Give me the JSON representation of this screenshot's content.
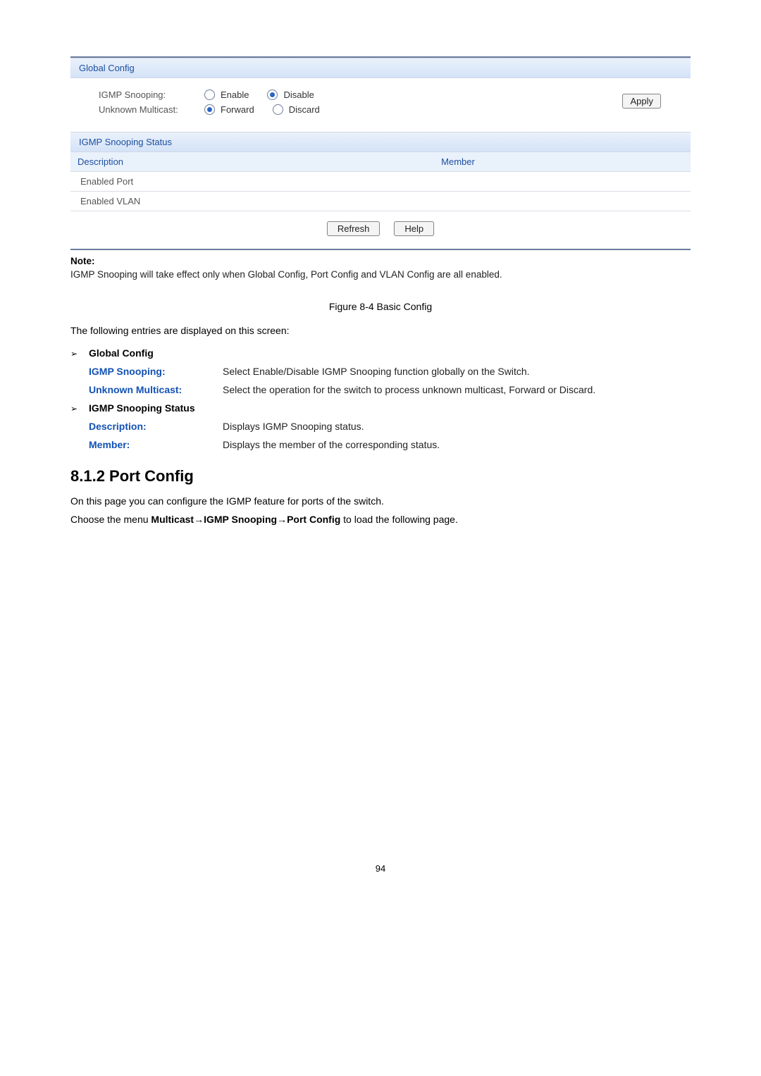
{
  "panel": {
    "global_header": "Global Config",
    "igmp_label": "IGMP Snooping:",
    "igmp_opt_enable": "Enable",
    "igmp_opt_disable": "Disable",
    "unknown_label": "Unknown Multicast:",
    "unknown_opt_forward": "Forward",
    "unknown_opt_discard": "Discard",
    "apply_btn": "Apply",
    "status_header": "IGMP Snooping Status",
    "col_description": "Description",
    "col_member": "Member",
    "row_enabled_port": "Enabled Port",
    "row_enabled_vlan": "Enabled VLAN",
    "refresh_btn": "Refresh",
    "help_btn": "Help"
  },
  "note": {
    "label": "Note:",
    "text": "IGMP Snooping will take effect only when Global Config, Port Config and VLAN Config are all enabled."
  },
  "figure_caption": "Figure 8-4 Basic Config",
  "intro": "The following entries are displayed on this screen:",
  "sections": {
    "global": {
      "title": "Global Config",
      "igmp": {
        "term": "IGMP Snooping:",
        "desc": "Select Enable/Disable IGMP Snooping function globally on the Switch."
      },
      "unknown": {
        "term": "Unknown Multicast:",
        "desc": "Select the operation for the switch to process unknown multicast, Forward or Discard."
      }
    },
    "status": {
      "title": "IGMP Snooping Status",
      "description": {
        "term": "Description:",
        "desc": "Displays IGMP Snooping status."
      },
      "member": {
        "term": "Member:",
        "desc": "Displays the member of the corresponding status."
      }
    }
  },
  "heading": "8.1.2 Port Config",
  "para1": "On this page you can configure the IGMP feature for ports of the switch.",
  "para2_pre": "Choose the menu ",
  "para2_b1": "Multicast",
  "para2_arrow": "→",
  "para2_b2": "IGMP Snooping",
  "para2_b3": "Port Config",
  "para2_post": " to load the following page.",
  "page_number": "94"
}
